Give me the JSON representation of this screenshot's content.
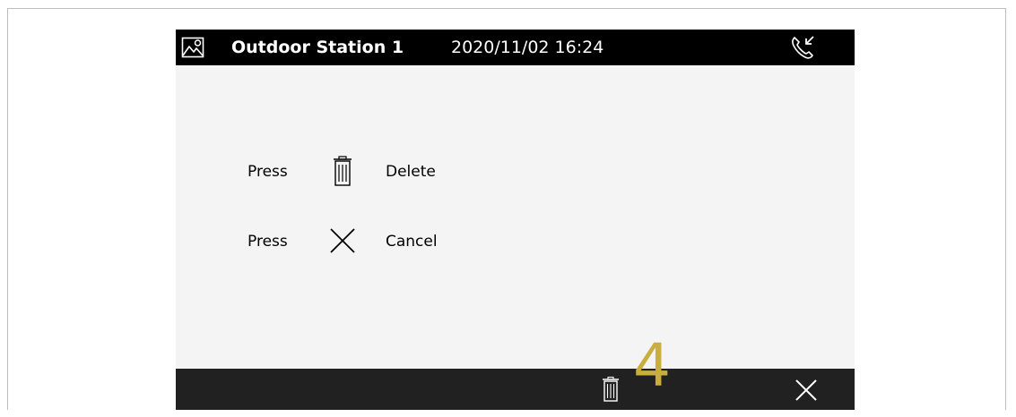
{
  "header": {
    "station_name": "Outdoor Station 1",
    "datetime": "2020/11/02 16:24",
    "left_icon": "gallery-icon",
    "right_icon": "incoming-call-icon"
  },
  "instructions": [
    {
      "prefix": "Press",
      "icon": "trash-icon",
      "action": "Delete"
    },
    {
      "prefix": "Press",
      "icon": "close-icon",
      "action": "Cancel"
    }
  ],
  "footer": {
    "buttons": [
      {
        "icon": "trash-icon"
      },
      {
        "icon": "close-icon"
      }
    ]
  },
  "callout": {
    "label": "4",
    "color": "#c9ad3f"
  },
  "colors": {
    "header_bg": "#000000",
    "footer_bg": "#212121",
    "screen_bg": "#f4f4f4"
  }
}
